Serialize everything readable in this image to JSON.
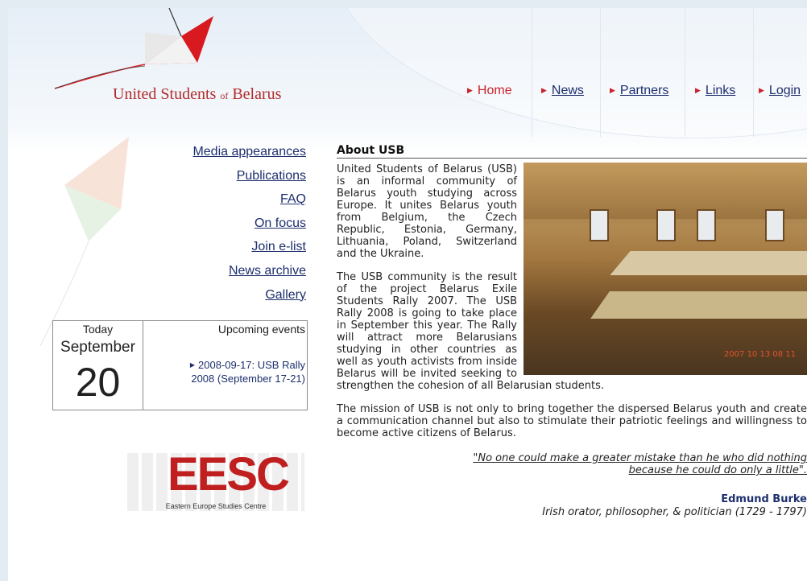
{
  "brand": {
    "name_before": "United Students ",
    "name_of": "of",
    "name_after": " Belarus"
  },
  "top_nav": [
    {
      "label": "Home",
      "active": true
    },
    {
      "label": "News",
      "active": false
    },
    {
      "label": "Partners",
      "active": false
    },
    {
      "label": "Links",
      "active": false
    },
    {
      "label": "Login",
      "active": false
    }
  ],
  "side_nav": [
    "Media appearances",
    "Publications",
    "FAQ",
    "On focus",
    "Join e-list",
    "News archive",
    "Gallery"
  ],
  "date_box": {
    "today_label": "Today",
    "month": "September",
    "day": "20",
    "upcoming_label": "Upcoming events",
    "event_line1": "2008-09-17: USB Rally",
    "event_line2": "2008 (September 17-21)"
  },
  "partner_logo": {
    "letters": "EESC",
    "caption": "Eastern Europe Studies Centre"
  },
  "article": {
    "title": "About USB",
    "p1": "United Students of Belarus (USB) is an informal community of Belarus youth studying across Europe. It unites Belarus youth from Belgium, the Czech Republic, Estonia, Germany, Lithuania, Poland, Switzerland and the Ukraine.",
    "p2": "The USB community is the result of the project Belarus Exile Students Rally 2007. The USB Rally 2008 is going to take place in September this year. The Rally will attract more Belarusians studying in other countries as well as youth activists from inside Belarus will be invited seeking to strengthen the cohesion of all Belarusian students.",
    "p3": "The mission of USB is not only to bring together the dispersed Belarus youth and create a communication channel but also to stimulate their patriotic feelings and willingness to become active citizens of Belarus.",
    "quote_line1": "\"No one could make a greater mistake than he who did nothing",
    "quote_line2": "because he could do only a little\".",
    "author": "Edmund Burke",
    "author_desc": "Irish orator, philosopher, & politician (1729 - 1797)",
    "photo_stamp": "2007 10 13 08 11"
  },
  "colors": {
    "brand_red": "#c8232c",
    "link_blue": "#1d2f6e"
  },
  "icons": [
    "arrow-right-icon",
    "kite-logo-icon"
  ]
}
